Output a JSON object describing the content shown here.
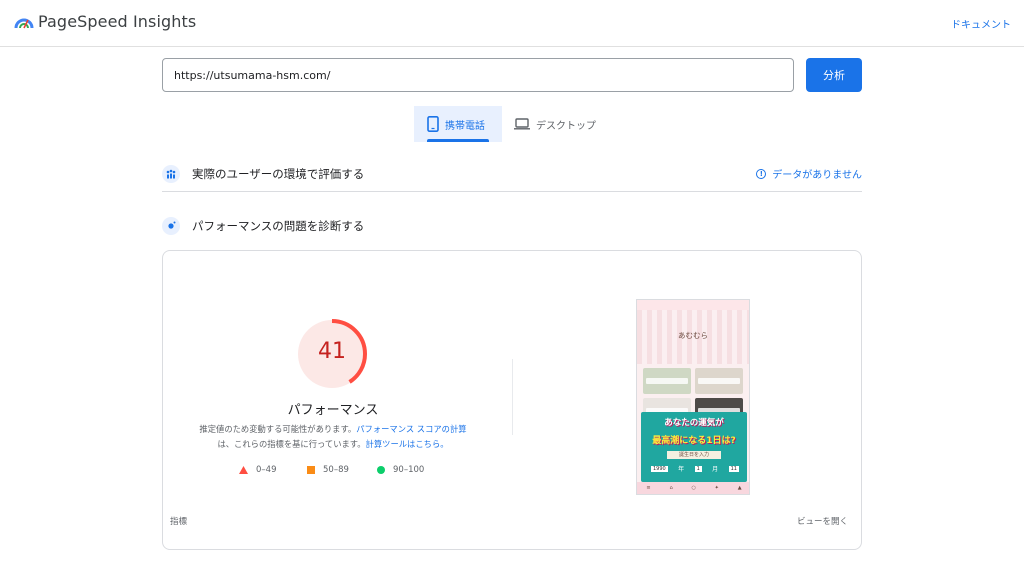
{
  "app": {
    "title": "PageSpeed Insights",
    "docs_link": "ドキュメント"
  },
  "search": {
    "url_value": "https://utsumama-hsm.com/",
    "analyze_label": "分析"
  },
  "device_tabs": {
    "mobile_label": "携帯電話",
    "desktop_label": "デスクトップ",
    "selected": "mobile"
  },
  "field_data": {
    "title": "実際のユーザーの環境で評価する",
    "status": "データがありません"
  },
  "lab_data": {
    "title": "パフォーマンスの問題を診断する"
  },
  "performance": {
    "score": "41",
    "score_fraction": 0.41,
    "label": "パフォーマンス",
    "desc_text_1": "推定値のため変動する可能性があります。",
    "desc_link_1": "パフォーマンス スコアの計算",
    "desc_text_2": "は、これらの指標を基に行っています。",
    "desc_link_2": "計算ツールはこちら。",
    "legend": {
      "fail": "0–49",
      "average": "50–89",
      "pass": "90–100"
    }
  },
  "screenshot": {
    "site_name": "あむむら",
    "banner_line1": "あなたの運気が",
    "banner_line2": "最高潮になる1日は?",
    "birth_label": "誕生日を入力",
    "year_value": "1990",
    "year_unit": "年",
    "month_value": "1",
    "month_unit": "月",
    "day_value": "11"
  },
  "footer": {
    "metrics_label": "指標",
    "view_treemap": "ビューを開く"
  },
  "colors": {
    "accent": "#1a73e8",
    "score_fail": "#c5221f",
    "gauge_arc": "#ff4e42",
    "gauge_bg": "#fce8e6",
    "average": "#fa8c16",
    "pass": "#0cce6b"
  }
}
